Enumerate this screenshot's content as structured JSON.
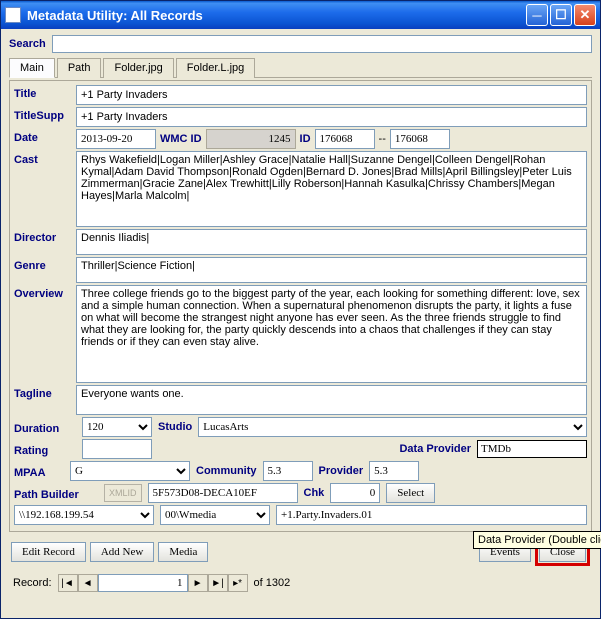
{
  "window": {
    "title": "Metadata Utility: All Records"
  },
  "search": {
    "label": "Search",
    "value": ""
  },
  "tabs": [
    "Main",
    "Path",
    "Folder.jpg",
    "Folder.L.jpg"
  ],
  "fields": {
    "title_label": "Title",
    "title_value": "+1 Party Invaders",
    "titlesupp_label": "TitleSupp",
    "titlesupp_value": "+1 Party Invaders",
    "date_label": "Date",
    "date_value": "2013-09-20",
    "wmcid_label": "WMC ID",
    "wmcid_value": "1245",
    "id_label": "ID",
    "id_value": "176068",
    "id_sep": "--",
    "id2_value": "176068",
    "cast_label": "Cast",
    "cast_value": "Rhys Wakefield|Logan Miller|Ashley Grace|Natalie Hall|Suzanne Dengel|Colleen Dengel|Rohan Kymal|Adam David Thompson|Ronald Ogden|Bernard D. Jones|Brad Mills|April Billingsley|Peter Luis Zimmerman|Gracie Zane|Alex Trewhitt|Lilly Roberson|Hannah Kasulka|Chrissy Chambers|Megan Hayes|Marla Malcolm|",
    "director_label": "Director",
    "director_value": "Dennis Iliadis|",
    "genre_label": "Genre",
    "genre_value": "Thriller|Science Fiction|",
    "overview_label": "Overview",
    "overview_value": "Three college friends go to the biggest party of the year, each looking for something different: love, sex and a simple human connection. When a supernatural phenomenon disrupts the party, it lights a fuse on what will become the strangest night anyone has ever seen. As the three friends struggle to find what they are looking for, the party quickly descends into a chaos that challenges if they can stay friends or if they can even stay alive.",
    "tagline_label": "Tagline",
    "tagline_value": "Everyone wants one.",
    "duration_label": "Duration",
    "duration_value": "120",
    "studio_label": "Studio",
    "studio_value": "LucasArts",
    "rating_label": "Rating",
    "rating_value": "",
    "dp_label": "Data Provider",
    "dp_value": "TMDb",
    "mpaa_label": "MPAA",
    "mpaa_value": "G",
    "community_label": "Community",
    "community_value": "5.3",
    "provider_label": "Provider",
    "provider_value": "5.3",
    "pathbuilder_label": "Path Builder",
    "xmlid_label": "XMLID",
    "pb_guid": "5F573D08-DECA10EF",
    "chk_label": "Chk",
    "chk_value": "0",
    "select_btn": "Select",
    "pb_path1": "\\\\192.168.199.54",
    "pb_path2": "00\\Wmedia",
    "pb_path3": "+1.Party.Invaders.01"
  },
  "buttons": {
    "edit_record": "Edit Record",
    "add_new": "Add New",
    "media": "Media",
    "events": "Events",
    "close": "Close"
  },
  "recordnav": {
    "label": "Record:",
    "current": "1",
    "of": "of  1302"
  },
  "tooltip": "Data Provider (Double click to edit)"
}
